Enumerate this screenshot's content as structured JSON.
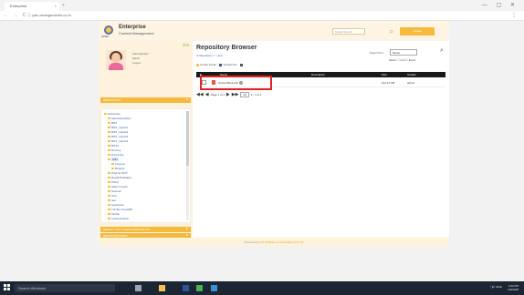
{
  "browser": {
    "tab_title": "Enterprise",
    "tab_close": "×",
    "new_tab": "+",
    "url": "ⓘ yalu.arrangements.co.in",
    "nav_icons": "← → C",
    "window_controls": "— ▢ ✕",
    "menu": "⋮"
  },
  "header": {
    "brand_line1": "Enterprise",
    "brand_line2": "Content Management",
    "logo_sub": "eDOC",
    "search_placeholder": "Global Search",
    "action_button": "Upload"
  },
  "sidebar": {
    "user_lines": [
      "Administrator",
      "admin",
      "Logout"
    ],
    "gear_icons": "⚙⚙",
    "repository_label": "REPOSITORY",
    "tree": [
      {
        "label": "Enterprise",
        "depth": 0
      },
      {
        "label": "Ideal Repository",
        "depth": 1
      },
      {
        "label": "BIFT",
        "depth": 1
      },
      {
        "label": "BIFT_import1",
        "depth": 1
      },
      {
        "label": "BIFT_import2",
        "depth": 1
      },
      {
        "label": "BIFT_import3",
        "depth": 1
      },
      {
        "label": "BIFT_import4",
        "depth": 1
      },
      {
        "label": "BIFTA",
        "depth": 1
      },
      {
        "label": "Dummy",
        "depth": 1
      },
      {
        "label": "Enterprise",
        "depth": 1
      },
      {
        "label": "Hills",
        "depth": 1,
        "selected": true
      },
      {
        "label": "Invoices",
        "depth": 2
      },
      {
        "label": "Reports",
        "depth": 2
      },
      {
        "label": "Paytmo 2017",
        "depth": 1
      },
      {
        "label": "Recall Packages",
        "depth": 1
      },
      {
        "label": "Policy",
        "depth": 1
      },
      {
        "label": "Sales Invoice",
        "depth": 1
      },
      {
        "label": "Scanner",
        "depth": 1
      },
      {
        "label": "Test",
        "depth": 1
      },
      {
        "label": "test",
        "depth": 1
      },
      {
        "label": "testservice",
        "depth": 1
      },
      {
        "label": "Trimble ImportEP",
        "depth": 1
      },
      {
        "label": "trimble",
        "depth": 1
      },
      {
        "label": "vytenarevision",
        "depth": 1
      }
    ],
    "section2_label": "SELECT ONLY USED & REPORTING",
    "section3_label": "REPORTING MENU"
  },
  "content": {
    "title": "Repository Browser",
    "breadcrumb": "➜ Repository > > test",
    "toolbar": [
      {
        "label": "Create Folder",
        "icon": "folder-icon",
        "color": "#f2c14e"
      },
      {
        "label": "Upload File",
        "icon": "upload-icon",
        "color": "#3a5a99"
      },
      {
        "label": "",
        "icon": "delete-icon",
        "color": "#555555"
      }
    ],
    "filter_label": "Search For",
    "filter_select": "Name",
    "filter_opts": "Match   ☐ Full   ☐ Exact",
    "columns": [
      "Name",
      "Description",
      "Size",
      "Creator"
    ],
    "rows": [
      {
        "name": "Online Bank.pdf",
        "description": "",
        "size": "101.17 KB",
        "creator": "admin"
      }
    ],
    "pager": {
      "first": "◀◀",
      "prev": "◀",
      "next": "▶",
      "last": "▶▶",
      "text": "Page 1 of 1",
      "per_page": "10",
      "items_text": "1 - 1 of 1"
    }
  },
  "footer": {
    "prefix": "Powered by ",
    "link": "GIT Software & Consultancy Pvt Ltd"
  },
  "taskbar": {
    "search_placeholder": "Search Windows",
    "tray": "^ 🔊 ENG",
    "time": "4:22 PM",
    "date": "2/2/2018",
    "apps": [
      {
        "icon": "task-view-icon",
        "color": "#9aa4b4"
      },
      {
        "icon": "file-explorer-icon",
        "color": "#f2c14e"
      },
      {
        "icon": "word-icon",
        "color": "#2b579a"
      },
      {
        "icon": "chrome-icon",
        "color": "#4caf50"
      },
      {
        "icon": "store-icon",
        "color": "#3b8fd6"
      }
    ]
  }
}
